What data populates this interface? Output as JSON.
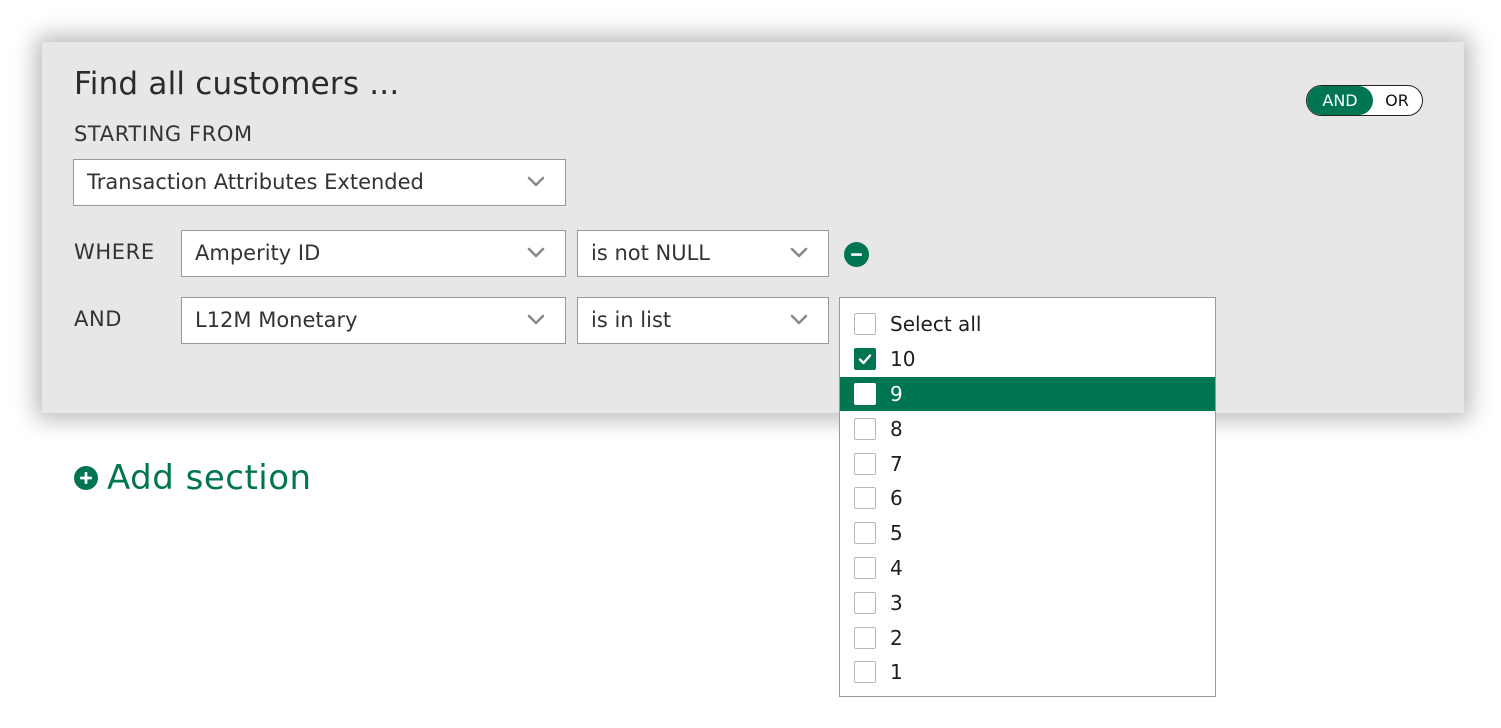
{
  "header": {
    "title": "Find all customers ...",
    "starting_from_label": "STARTING FROM"
  },
  "logic_toggle": {
    "options": [
      "AND",
      "OR"
    ],
    "selected": "AND"
  },
  "source_select": {
    "value": "Transaction Attributes Extended",
    "icon": "chevron-down-icon"
  },
  "conditions": [
    {
      "connector": "WHERE",
      "field": "Amperity ID",
      "operator": "is not NULL",
      "removable": true
    },
    {
      "connector": "AND",
      "field": "L12M Monetary",
      "operator": "is in list",
      "removable": false
    }
  ],
  "add_section": {
    "label": "Add section",
    "icon": "plus-circle-icon"
  },
  "value_list": {
    "items": [
      {
        "label": "Select all",
        "checked": false,
        "highlighted": false
      },
      {
        "label": "10",
        "checked": true,
        "highlighted": false
      },
      {
        "label": "9",
        "checked": false,
        "highlighted": true
      },
      {
        "label": "8",
        "checked": false,
        "highlighted": false
      },
      {
        "label": "7",
        "checked": false,
        "highlighted": false
      },
      {
        "label": "6",
        "checked": false,
        "highlighted": false
      },
      {
        "label": "5",
        "checked": false,
        "highlighted": false
      },
      {
        "label": "4",
        "checked": false,
        "highlighted": false
      },
      {
        "label": "3",
        "checked": false,
        "highlighted": false
      },
      {
        "label": "2",
        "checked": false,
        "highlighted": false
      },
      {
        "label": "1",
        "checked": false,
        "highlighted": false
      }
    ]
  },
  "colors": {
    "accent": "#007552",
    "card_background": "#e7e7e7"
  }
}
